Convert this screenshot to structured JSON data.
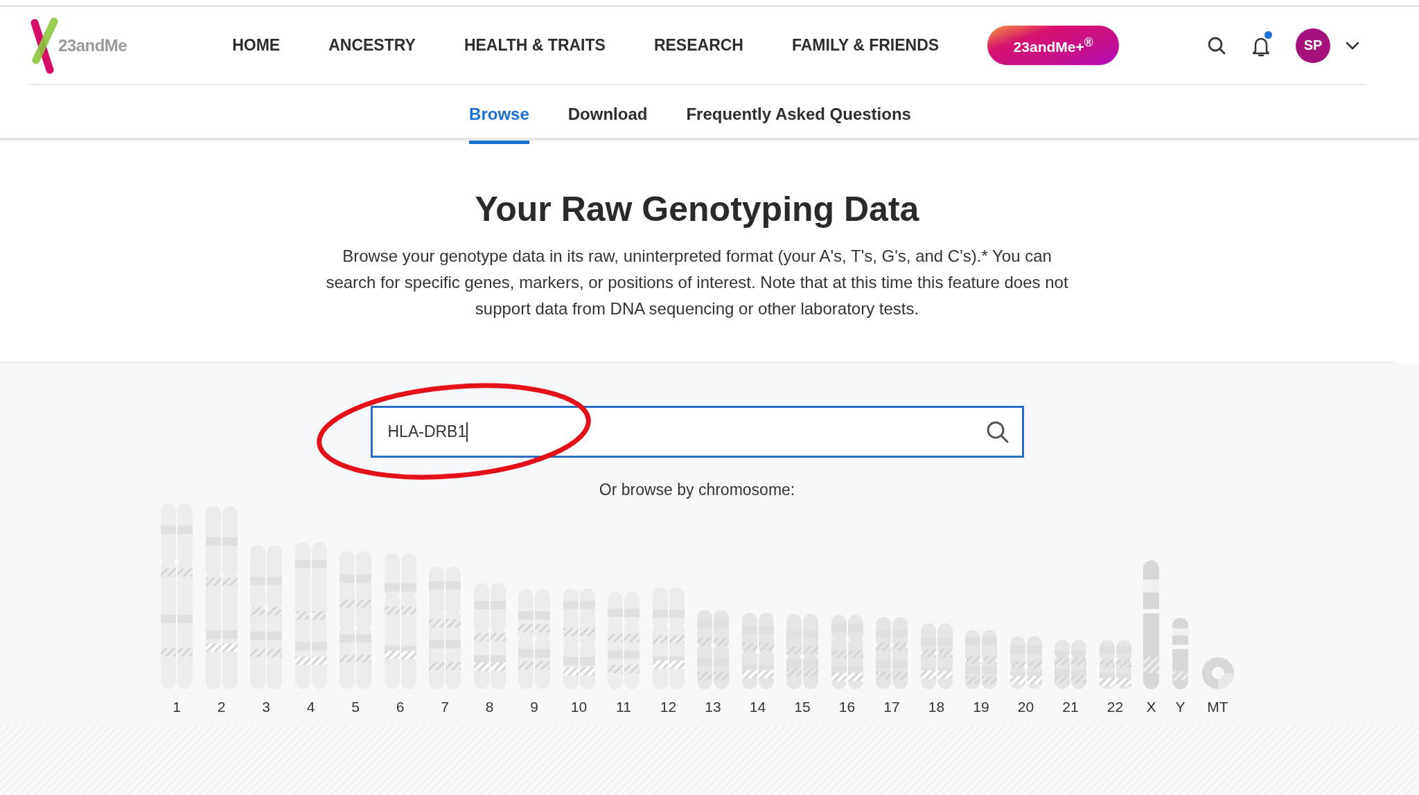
{
  "logo": {
    "text": "23andMe"
  },
  "nav": [
    {
      "label": "HOME"
    },
    {
      "label": "ANCESTRY"
    },
    {
      "label": "HEALTH & TRAITS"
    },
    {
      "label": "RESEARCH"
    },
    {
      "label": "FAMILY & FRIENDS"
    }
  ],
  "plus_button": {
    "label": "23andMe+$^{®}$"
  },
  "notifications": {
    "unread": true
  },
  "avatar": {
    "initials": "SP"
  },
  "tabs": [
    {
      "label": "Browse",
      "selected": true
    },
    {
      "label": "Download",
      "selected": false
    },
    {
      "label": "Frequently Asked Questions",
      "selected": false
    }
  ],
  "heading": "Your Raw Genotyping Data",
  "description": "Browse your genotype data in its raw, uninterpreted format (your A's, T's, G's, and C's).* You can search for specific genes, markers, or positions of interest. Note that at this time this feature does not support data from DNA sequencing or other laboratory tests.",
  "search": {
    "value": "HLA-DRB1"
  },
  "browse_label": "Or browse by chromosome:",
  "chromosomes": [
    {
      "label": "1",
      "kind": "pair"
    },
    {
      "label": "2",
      "kind": "pair"
    },
    {
      "label": "3",
      "kind": "pair"
    },
    {
      "label": "4",
      "kind": "pair"
    },
    {
      "label": "5",
      "kind": "pair"
    },
    {
      "label": "6",
      "kind": "pair"
    },
    {
      "label": "7",
      "kind": "pair"
    },
    {
      "label": "8",
      "kind": "pair"
    },
    {
      "label": "9",
      "kind": "pair"
    },
    {
      "label": "10",
      "kind": "pair"
    },
    {
      "label": "11",
      "kind": "pair"
    },
    {
      "label": "12",
      "kind": "pair"
    },
    {
      "label": "13",
      "kind": "pair"
    },
    {
      "label": "14",
      "kind": "pair"
    },
    {
      "label": "15",
      "kind": "pair"
    },
    {
      "label": "16",
      "kind": "pair"
    },
    {
      "label": "17",
      "kind": "pair"
    },
    {
      "label": "18",
      "kind": "pair"
    },
    {
      "label": "19",
      "kind": "pair"
    },
    {
      "label": "20",
      "kind": "pair"
    },
    {
      "label": "21",
      "kind": "pair"
    },
    {
      "label": "22",
      "kind": "pair"
    },
    {
      "label": "X",
      "kind": "single"
    },
    {
      "label": "Y",
      "kind": "single"
    },
    {
      "label": "MT",
      "kind": "ring"
    }
  ]
}
